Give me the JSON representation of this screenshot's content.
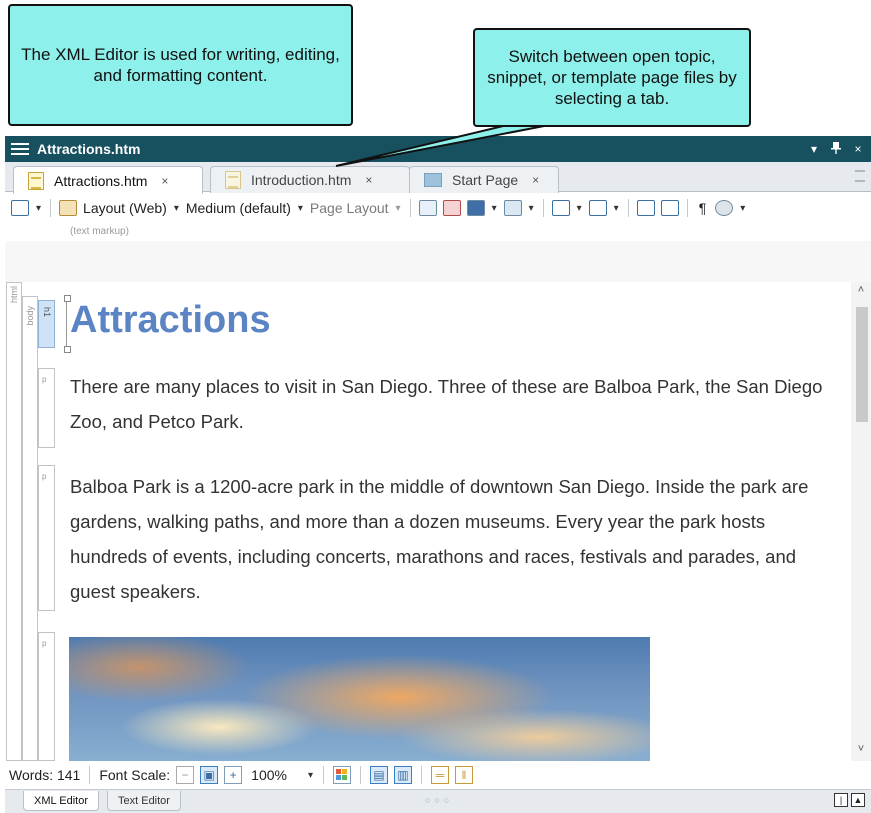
{
  "callouts": {
    "xml_editor": "The XML Editor is used for writing, editing, and formatting content.",
    "tabs": "Switch between open topic, snippet, or template page files by selecting a tab."
  },
  "window": {
    "title": "Attractions.htm",
    "controls": {
      "dropdown": "▾",
      "pin": "📌",
      "close": "×"
    }
  },
  "tabs": [
    {
      "label": "Attractions.htm",
      "close": "×",
      "active": true
    },
    {
      "label": "Introduction.htm",
      "close": "×",
      "active": false
    },
    {
      "label": "Start Page",
      "close": "×",
      "active": false
    }
  ],
  "toolbar": {
    "layout": "Layout (Web)",
    "medium": "Medium (default)",
    "page_layout": "Page Layout",
    "pilcrow": "¶",
    "text_markup": "(text markup)"
  },
  "structure": {
    "html": "html",
    "body": "body",
    "h1": "h1",
    "p": "p"
  },
  "document": {
    "heading": "Attractions",
    "paragraphs": [
      "There are many places to visit in San Diego. Three of these are Balboa Park, the San Diego Zoo, and Petco Park.",
      "Balboa Park is a 1200-acre park in the middle of downtown San Diego. Inside the park are gardens, walking paths, and more than a dozen museums. Every year the park hosts hundreds of events, including concerts, marathons and races, festivals and parades, and guest speakers."
    ]
  },
  "statusbar": {
    "words": "Words: 141",
    "font_scale": "Font Scale:",
    "zoom": "100%"
  },
  "bottom_tabs": [
    {
      "label": "XML Editor",
      "active": true
    },
    {
      "label": "Text Editor",
      "active": false
    }
  ],
  "colors": {
    "titlebar": "#17505f",
    "callout": "#8ef0ea",
    "heading": "#5a84c4"
  }
}
